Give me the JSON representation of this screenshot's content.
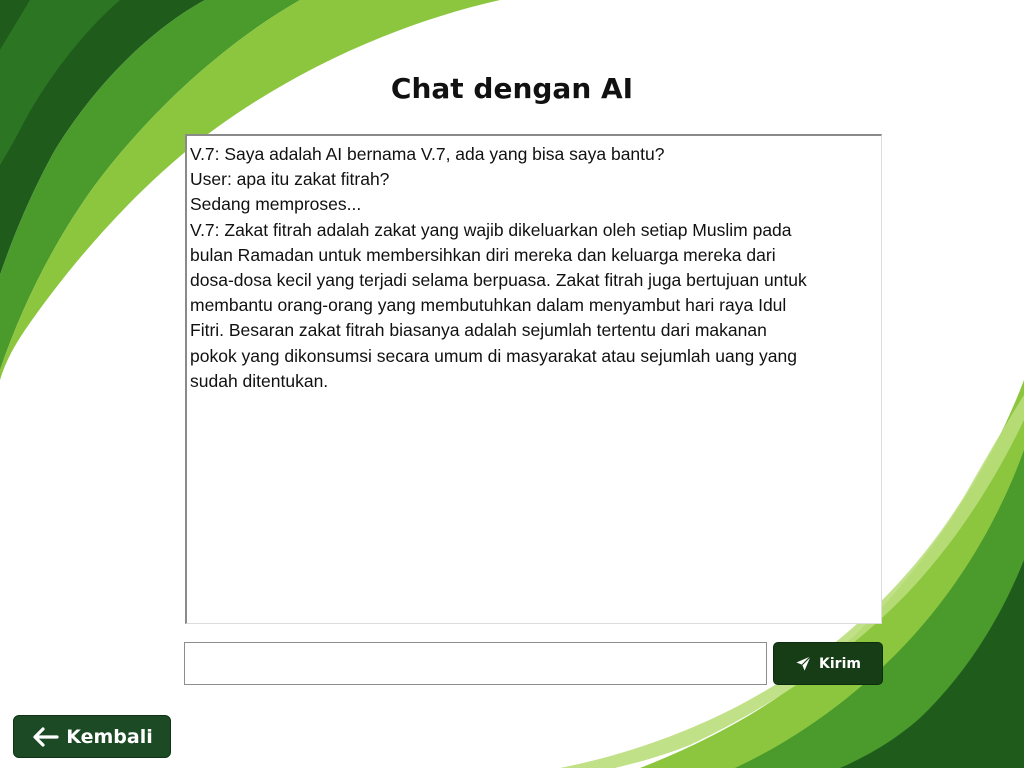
{
  "page": {
    "title": "Chat dengan AI"
  },
  "chat": {
    "messages": [
      {
        "text": "V.7: Saya adalah AI bernama V.7, ada yang bisa saya bantu?"
      },
      {
        "text": "User: apa itu zakat fitrah?"
      },
      {
        "text": "Sedang memproses..."
      },
      {
        "text": "V.7: Zakat fitrah adalah zakat yang wajib dikeluarkan oleh setiap Muslim pada\nbulan Ramadan untuk membersihkan diri mereka dan keluarga mereka dari\ndosa-dosa kecil yang terjadi selama berpuasa. Zakat fitrah juga bertujuan untuk\nmembantu orang-orang yang membutuhkan dalam menyambut hari raya Idul\nFitri. Besaran zakat fitrah biasanya adalah sejumlah tertentu dari makanan\npokok yang dikonsumsi secara umum di masyarakat atau sejumlah uang yang\nsudah ditentukan."
      }
    ],
    "input_value": "",
    "send_label": "Kirim",
    "send_icon": "send-icon"
  },
  "nav": {
    "back_label": "Kembali",
    "back_icon": "arrow-left-icon"
  },
  "colors": {
    "dark_green": "#163d16",
    "button_green": "#1b4a24",
    "mid_green": "#3f8f2a",
    "light_green": "#8cc63f",
    "background": "#ffffff"
  }
}
